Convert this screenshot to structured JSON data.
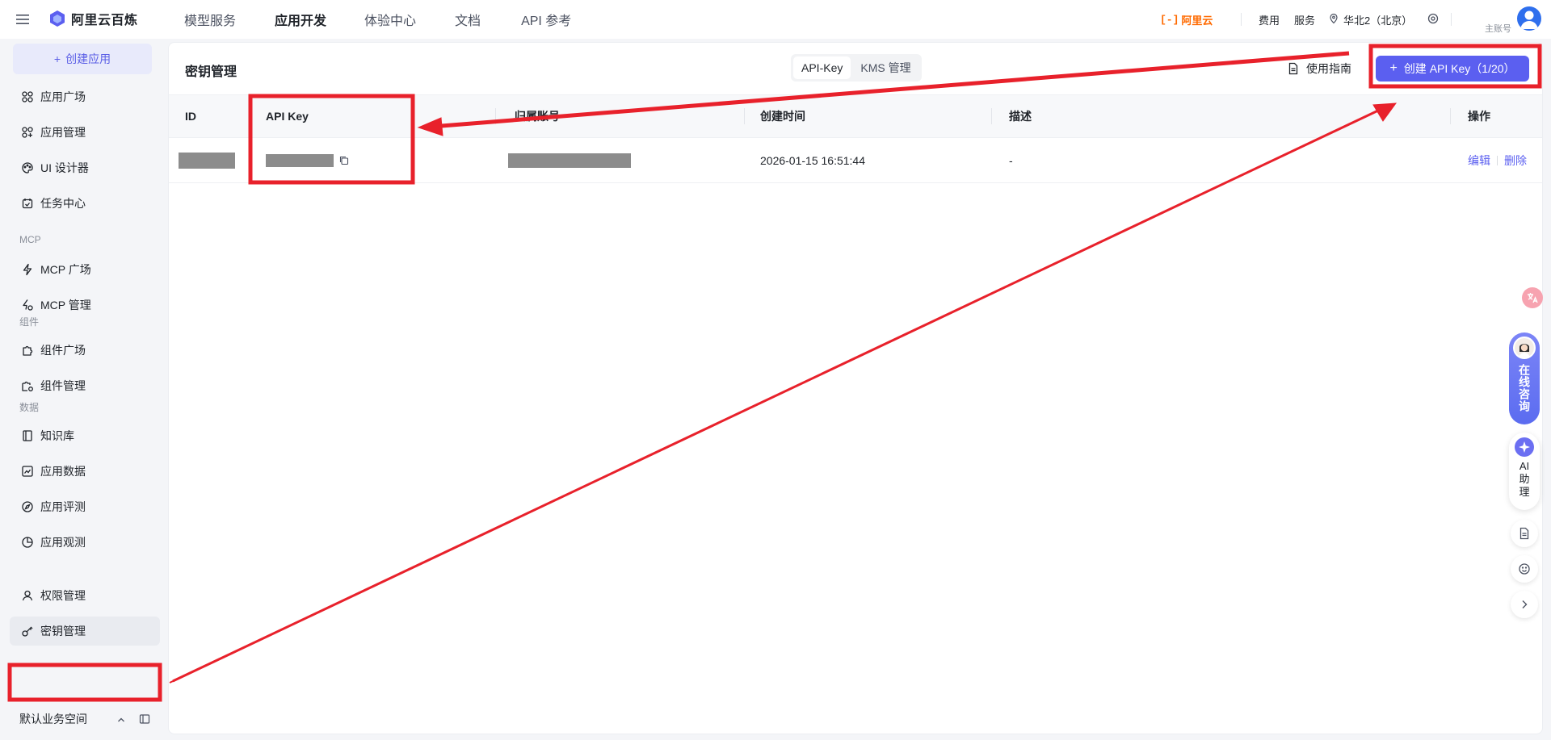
{
  "brand": {
    "name": "阿里云百炼"
  },
  "topnav": {
    "items": [
      "模型服务",
      "应用开发",
      "体验中心",
      "文档",
      "API 参考"
    ],
    "active_index": 1
  },
  "topright": {
    "aliyun_brand": "阿里云",
    "fees": "费用",
    "service": "服务",
    "region": "华北2（北京）",
    "account_label": "主账号"
  },
  "sidebar": {
    "create_app": "创建应用",
    "items": [
      {
        "label": "应用广场",
        "icon": "grid-icon"
      },
      {
        "label": "应用管理",
        "icon": "grid-icon"
      },
      {
        "label": "UI 设计器",
        "icon": "palette-icon"
      },
      {
        "label": "任务中心",
        "icon": "task-icon"
      },
      {
        "label": "MCP 广场",
        "icon": "bolt-icon"
      },
      {
        "label": "MCP 管理",
        "icon": "bolt-settings-icon"
      },
      {
        "label": "组件广场",
        "icon": "puzzle-icon"
      },
      {
        "label": "组件管理",
        "icon": "puzzle-settings-icon"
      },
      {
        "label": "知识库",
        "icon": "book-icon"
      },
      {
        "label": "应用数据",
        "icon": "chart-icon"
      },
      {
        "label": "应用评测",
        "icon": "compass-icon"
      },
      {
        "label": "应用观测",
        "icon": "pie-icon"
      },
      {
        "label": "权限管理",
        "icon": "user-icon"
      },
      {
        "label": "密钥管理",
        "icon": "key-icon"
      }
    ],
    "groups": [
      "MCP",
      "组件",
      "数据"
    ],
    "active_item": "密钥管理",
    "workspace": "默认业务空间"
  },
  "main": {
    "title": "密钥管理",
    "segments": [
      "API-Key",
      "KMS 管理"
    ],
    "active_segment": "API-Key",
    "guide": "使用指南",
    "create_button": "创建 API Key（1/20）",
    "columns": [
      "ID",
      "API Key",
      "归属账号",
      "创建时间",
      "描述",
      "操作"
    ],
    "rows": [
      {
        "created_at": "2026-01-15 16:51:44",
        "description": "-",
        "actions": [
          "编辑",
          "删除"
        ]
      }
    ]
  },
  "floating": {
    "consult": "在线咨询",
    "assistant": "AI助理"
  },
  "colors": {
    "accent": "#5b5ff0",
    "annotation": "#e8212b",
    "aliyun_orange": "#ff6a00"
  }
}
